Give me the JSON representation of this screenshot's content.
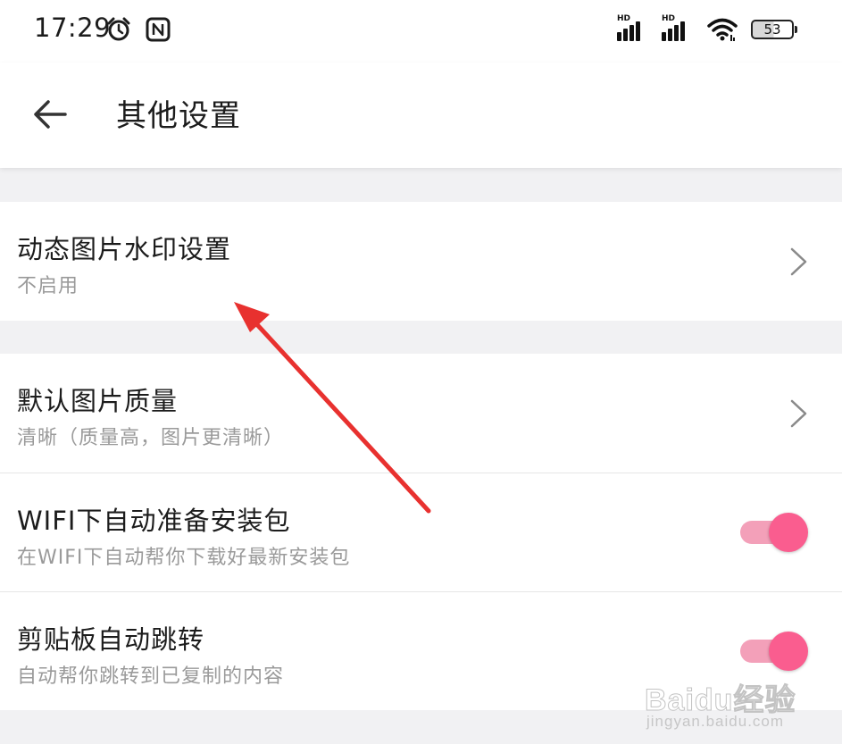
{
  "status_bar": {
    "time": "17:29",
    "battery_level": "53",
    "signal_1_label": "HD",
    "signal_2_label": "HD",
    "icons": [
      "alarm-icon",
      "nfc-icon",
      "hd-signal-icon",
      "hd-signal-icon",
      "wifi-icon",
      "battery-icon"
    ]
  },
  "header": {
    "title": "其他设置",
    "back_icon": "arrow-left-icon"
  },
  "sections": [
    {
      "items": [
        {
          "title": "动态图片水印设置",
          "subtitle": "不启用",
          "control": "chevron"
        }
      ]
    },
    {
      "items": [
        {
          "title": "默认图片质量",
          "subtitle": "清晰（质量高，图片更清晰）",
          "control": "chevron"
        },
        {
          "title": "WIFI下自动准备安装包",
          "subtitle": "在WIFI下自动帮你下载好最新安装包",
          "control": "toggle",
          "enabled": true
        },
        {
          "title": "剪贴板自动跳转",
          "subtitle": "自动帮你跳转到已复制的内容",
          "control": "toggle",
          "enabled": true
        }
      ]
    }
  ],
  "colors": {
    "toggle_on_knob": "#fa5d8f",
    "toggle_on_track": "#f3a0b9",
    "annotation_arrow": "#e8312f",
    "background": "#f1f1f3"
  },
  "watermark": {
    "brand": "Baidu经验",
    "url": "jingyan.baidu.com"
  }
}
